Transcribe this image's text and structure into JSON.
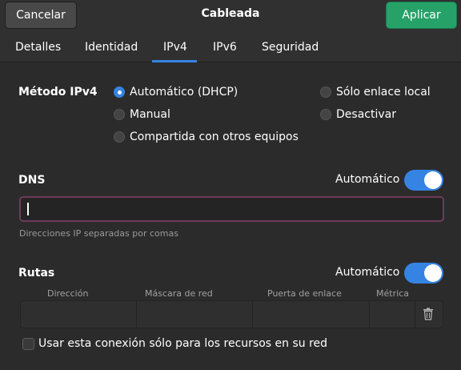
{
  "header": {
    "cancel_label": "Cancelar",
    "title": "Cableada",
    "apply_label": "Aplicar"
  },
  "tabs": [
    {
      "label": "Detalles"
    },
    {
      "label": "Identidad"
    },
    {
      "label": "IPv4",
      "active": true
    },
    {
      "label": "IPv6"
    },
    {
      "label": "Seguridad"
    }
  ],
  "ipv4": {
    "method_label": "Método IPv4",
    "options": [
      {
        "label": "Automático (DHCP)",
        "checked": true
      },
      {
        "label": "Manual",
        "checked": false
      },
      {
        "label": "Compartida con otros equipos",
        "checked": false
      },
      {
        "label": "Sólo enlace local",
        "checked": false
      },
      {
        "label": "Desactivar",
        "checked": false
      }
    ]
  },
  "dns": {
    "label": "DNS",
    "auto_label": "Automático",
    "auto_enabled": true,
    "value": "",
    "hint": "Direcciones IP separadas por comas"
  },
  "routes": {
    "label": "Rutas",
    "auto_label": "Automático",
    "auto_enabled": true,
    "columns": [
      "Dirección",
      "Máscara de red",
      "Puerta de enlace",
      "Métrica"
    ],
    "row": {
      "address": "",
      "netmask": "",
      "gateway": "",
      "metric": ""
    }
  },
  "only_resources": {
    "label": "Usar esta conexión sólo para los recursos en su red",
    "checked": false
  },
  "colors": {
    "accent": "#3584e4",
    "apply": "#26a269",
    "focus_border": "#6e3a5a",
    "background": "#2b2b2b"
  },
  "icons": {
    "radio": "radio-icon",
    "toggle": "toggle-switch",
    "trash": "trash-icon",
    "checkbox": "checkbox-icon"
  }
}
